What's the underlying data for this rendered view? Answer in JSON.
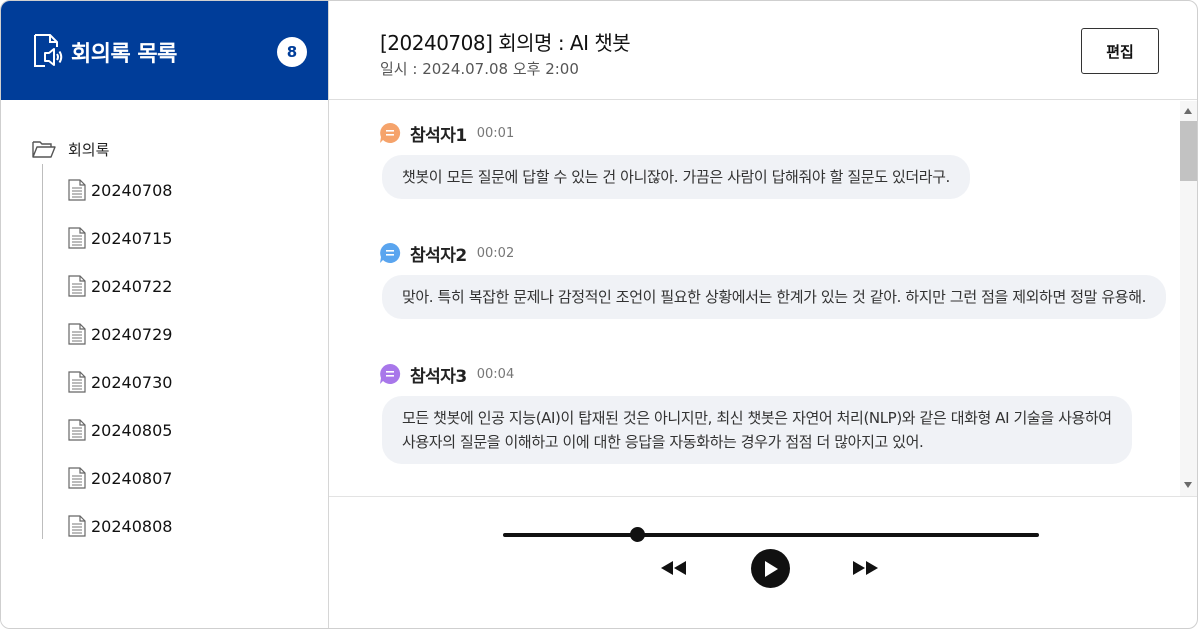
{
  "sidebar": {
    "title": "회의록 목록",
    "count": "8",
    "root_label": "회의록",
    "items": [
      {
        "label": "20240708"
      },
      {
        "label": "20240715"
      },
      {
        "label": "20240722"
      },
      {
        "label": "20240729"
      },
      {
        "label": "20240730"
      },
      {
        "label": "20240805"
      },
      {
        "label": "20240807"
      },
      {
        "label": "20240808"
      }
    ]
  },
  "header": {
    "title": "[20240708] 회의명 : AI 챗봇",
    "date": "일시 : 2024.07.08  오후 2:00",
    "edit_label": "편집"
  },
  "messages": [
    {
      "speaker": "참석자1",
      "time": "00:01",
      "color": "#f5a36b",
      "lines": [
        "챗봇이 모든 질문에 답할 수 있는 건 아니잖아. 가끔은 사람이 답해줘야 할 질문도 있더라구."
      ]
    },
    {
      "speaker": "참석자2",
      "time": "00:02",
      "color": "#5aa5ef",
      "lines": [
        "맞아. 특히 복잡한 문제나 감정적인 조언이 필요한 상황에서는 한계가 있는 것 같아. 하지만 그런 점을 제외하면 정말 유용해."
      ]
    },
    {
      "speaker": "참석자3",
      "time": "00:04",
      "color": "#a877ea",
      "lines": [
        "모든 챗봇에 인공 지능(AI)이 탑재된 것은 아니지만, 최신 챗봇은 자연어 처리(NLP)와 같은 대화형 AI 기술을 사용하여",
        "사용자의 질문을 이해하고 이에 대한 응답을 자동화하는 경우가 점점 더 많아지고 있어."
      ]
    }
  ],
  "player": {
    "progress": 0.25
  },
  "colors": {
    "brand": "#003d99",
    "bubble": "#f0f2f6"
  }
}
